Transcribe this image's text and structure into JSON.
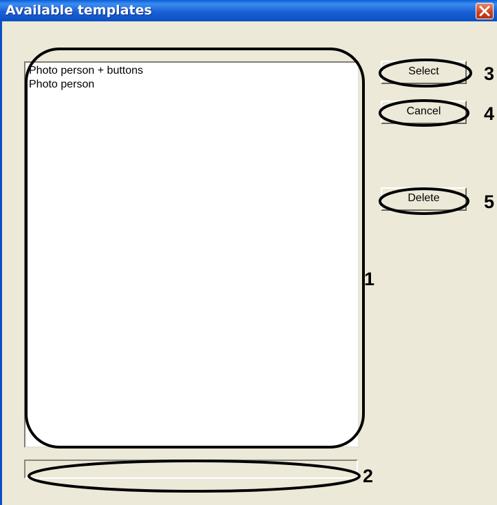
{
  "window": {
    "title": "Available templates"
  },
  "templates": [
    "Photo person + buttons",
    "Photo person"
  ],
  "name_field": {
    "value": ""
  },
  "buttons": {
    "select": "Select",
    "cancel": "Cancel",
    "delete": "Delete"
  },
  "callouts": [
    "1",
    "2",
    "3",
    "4",
    "5"
  ],
  "colors": {
    "titlebar": "#0a5fd8",
    "close": "#c9401c",
    "window_bg": "#ece9d8"
  }
}
